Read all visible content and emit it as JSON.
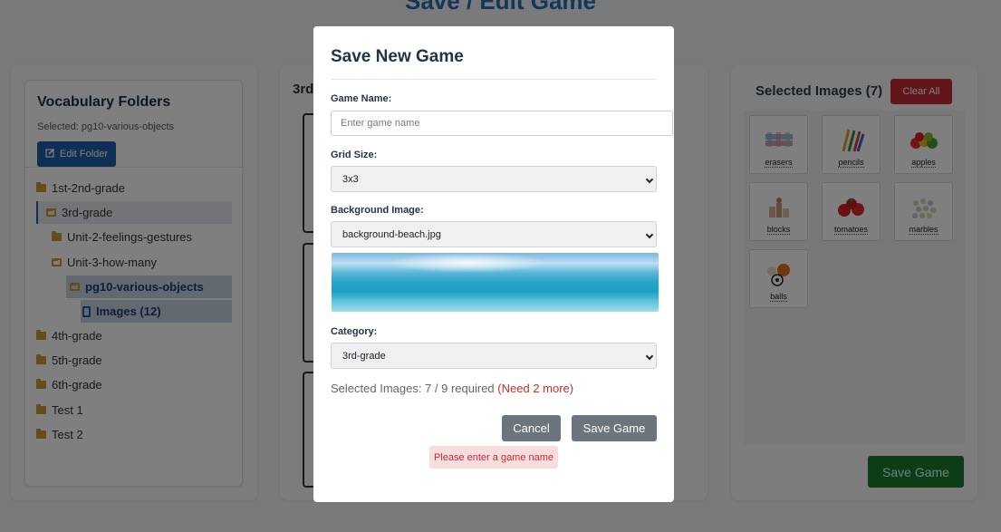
{
  "page": {
    "title": "Save / Edit Game"
  },
  "folders_panel": {
    "title": "Vocabulary Folders",
    "selected_text": "Selected: pg10-various-objects",
    "edit_button": "Edit Folder",
    "tree": [
      {
        "label": "1st-2nd-grade"
      },
      {
        "label": "3rd-grade"
      },
      {
        "label": "Unit-2-feelings-gestures"
      },
      {
        "label": "Unit-3-how-many"
      },
      {
        "label": "pg10-various-objects"
      },
      {
        "label": "Images (12)"
      },
      {
        "label": "4th-grade"
      },
      {
        "label": "5th-grade"
      },
      {
        "label": "6th-grade"
      },
      {
        "label": "Test 1"
      },
      {
        "label": "Test 2"
      }
    ]
  },
  "center_panel": {
    "title": "3rd"
  },
  "selected_panel": {
    "title": "Selected Images (7)",
    "clear_all": "Clear All",
    "images": [
      {
        "label": "erasers",
        "icon": "erasers-icon"
      },
      {
        "label": "pencils",
        "icon": "pencils-icon"
      },
      {
        "label": "apples",
        "icon": "apples-icon"
      },
      {
        "label": "blocks",
        "icon": "blocks-icon"
      },
      {
        "label": "tomatoes",
        "icon": "tomatoes-icon"
      },
      {
        "label": "marbles",
        "icon": "marbles-icon"
      },
      {
        "label": "balls",
        "icon": "balls-icon"
      }
    ],
    "save_button": "Save Game"
  },
  "modal": {
    "title": "Save New Game",
    "game_name_label": "Game Name:",
    "game_name_value": "",
    "game_name_placeholder": "Enter game name",
    "grid_size_label": "Grid Size:",
    "grid_size_value": "3x3",
    "background_label": "Background Image:",
    "background_value": "background-beach.jpg",
    "category_label": "Category:",
    "category_value": "3rd-grade",
    "status_text": "Selected Images: 7 / 9 required",
    "status_need": "(Need 2 more)",
    "cancel_button": "Cancel",
    "save_button": "Save Game",
    "error_text": "Please enter a game name"
  },
  "colors": {
    "primary": "#1f5faa",
    "danger": "#c42a36",
    "success": "#1a7a2e",
    "secondary": "#6c757d"
  }
}
